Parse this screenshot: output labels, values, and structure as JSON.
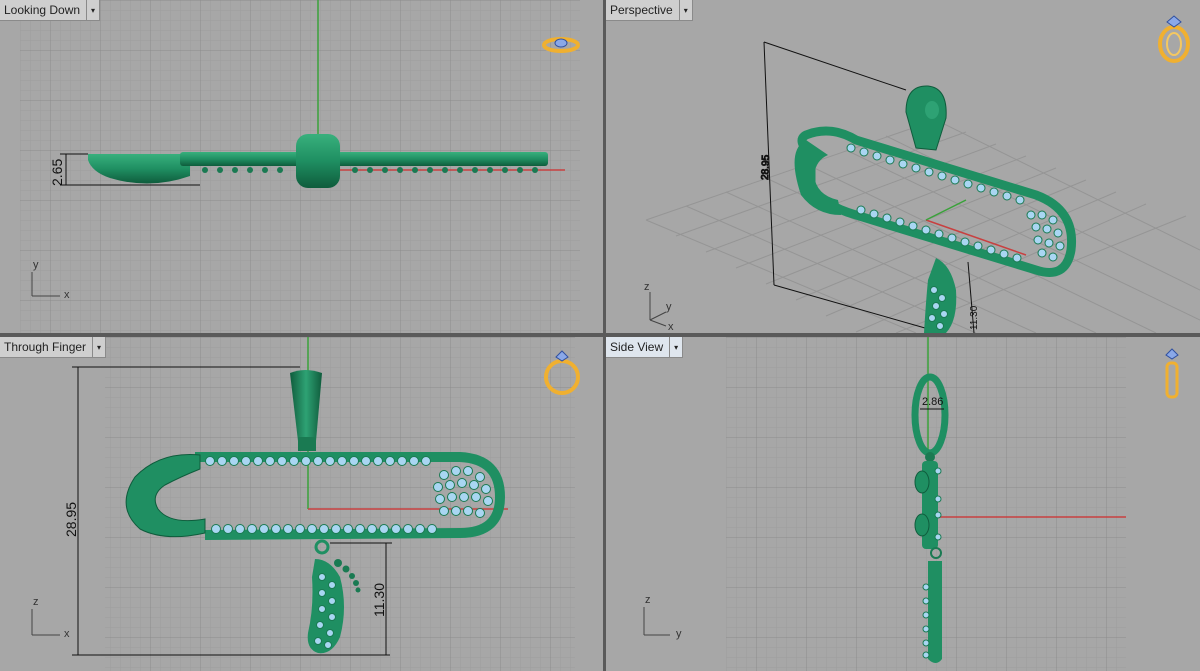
{
  "viewports": {
    "top": {
      "title": "Looking Down",
      "menu_glyph": "▾",
      "dimension": "2.65",
      "axis_v": "y",
      "axis_h": "x"
    },
    "perspective": {
      "title": "Perspective",
      "menu_glyph": "▾",
      "dimension_height": "28.95",
      "dimension_charm": "11.30",
      "axis_v": "z",
      "axis_y": "y",
      "axis_h": "x"
    },
    "front": {
      "title": "Through Finger",
      "menu_glyph": "▾",
      "dimension_height": "28.95",
      "dimension_charm": "11.30",
      "axis_v": "z",
      "axis_h": "x"
    },
    "side": {
      "title": "Side View",
      "menu_glyph": "▾",
      "dimension": "2.86",
      "axis_v": "z",
      "axis_h": "y"
    }
  },
  "icons": {
    "top": "ring-top-view-icon",
    "perspective": "ring-perspective-icon",
    "front": "ring-front-view-icon",
    "side": "ring-side-view-icon"
  },
  "colors": {
    "viewport_bg": "#a7a7a7",
    "grid_minor": "#9b9b9b",
    "grid_major": "#8c8c8c",
    "axis_green": "#3aa23a",
    "axis_red": "#c84040",
    "metal_green": "#1f8f62",
    "gem_blue": "#a9d6f2",
    "ring_gold": "#f0b030",
    "tab_bg": "#cfcfcf",
    "tab_active_bg": "#dfe6ee"
  }
}
